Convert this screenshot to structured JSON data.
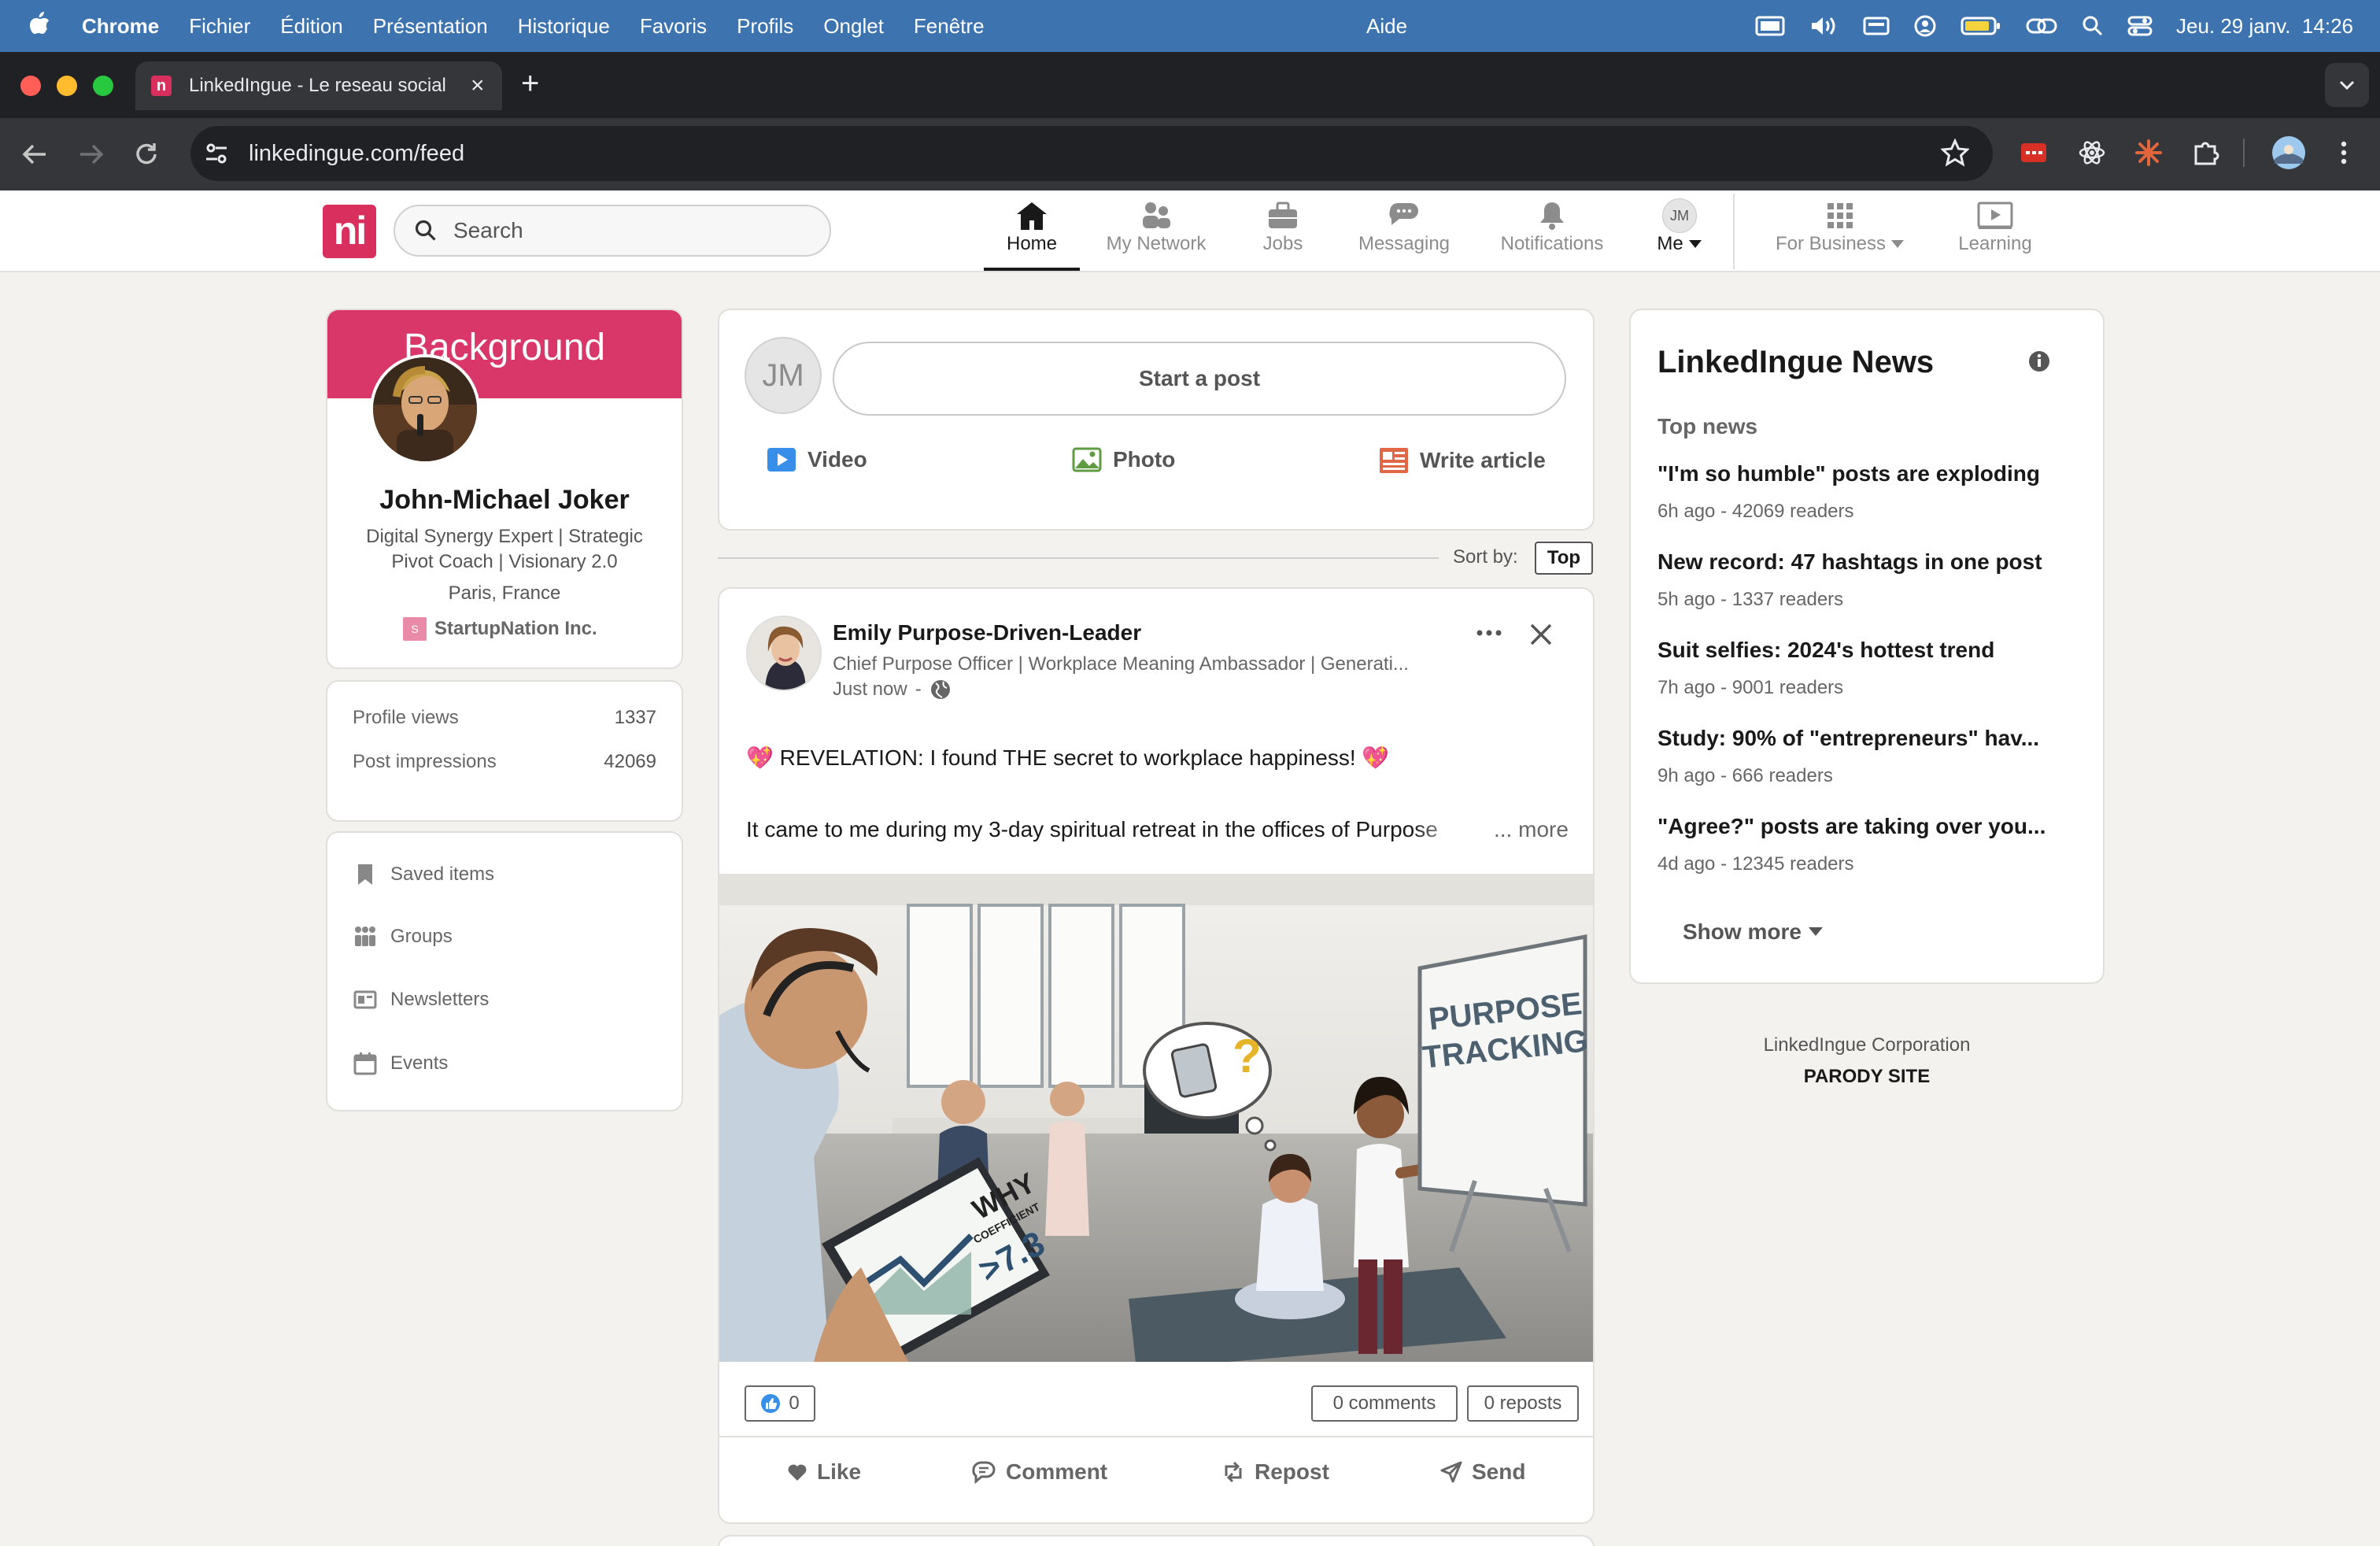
{
  "menubar": {
    "app": "Chrome",
    "items": [
      "Fichier",
      "Édition",
      "Présentation",
      "Historique",
      "Favoris",
      "Profils",
      "Onglet",
      "Fenêtre"
    ],
    "help": "Aide",
    "clock": "Jeu. 29 janv.  14:26"
  },
  "browser": {
    "tab_title": "LinkedIngue - Le reseau social",
    "url": "linkedingue.com/feed"
  },
  "site": {
    "logo": "ni",
    "search_placeholder": "Search",
    "nav": {
      "home": "Home",
      "network": "My Network",
      "jobs": "Jobs",
      "messaging": "Messaging",
      "notifications": "Notifications",
      "me_avatar": "JM",
      "me": "Me",
      "business": "For Business",
      "learning": "Learning"
    }
  },
  "profile": {
    "banner": "Background",
    "name": "John-Michael Joker",
    "headline": "Digital Synergy Expert | Strategic Pivot Coach | Visionary 2.0",
    "location": "Paris, France",
    "company_badge": "S",
    "company": "StartupNation Inc.",
    "stats": [
      {
        "label": "Profile views",
        "value": "1337"
      },
      {
        "label": "Post impressions",
        "value": "42069"
      }
    ],
    "menu": [
      "Saved items",
      "Groups",
      "Newsletters",
      "Events"
    ]
  },
  "composer": {
    "avatar": "JM",
    "start": "Start a post",
    "video": "Video",
    "photo": "Photo",
    "article": "Write article"
  },
  "feed": {
    "sort_label": "Sort by:",
    "sort_value": "Top"
  },
  "post": {
    "author": "Emily Purpose-Driven-Leader",
    "subtitle": "Chief Purpose Officer | Workplace Meaning Ambassador | Generati...",
    "time": "Just now",
    "dash": "-",
    "text1": "💖 REVELATION: I found THE secret to workplace happiness! 💖",
    "text2": "It came to me during my 3-day spiritual retreat in the offices of Purpose",
    "more": "... more",
    "image": {
      "board_line1": "PURPOSE",
      "board_line2": "TRACKING",
      "tablet_big": "WHY",
      "tablet_small": "COEFFICIENT",
      "tablet_value": ">7.3"
    },
    "reactions": "0",
    "comments": "0 comments",
    "reposts": "0 reposts",
    "actions": {
      "like": "Like",
      "comment": "Comment",
      "repost": "Repost",
      "send": "Send"
    }
  },
  "news": {
    "title": "LinkedIngue News",
    "section": "Top news",
    "items": [
      {
        "title": "\"I'm so humble\" posts are exploding",
        "meta": "6h ago - 42069 readers"
      },
      {
        "title": "New record: 47 hashtags in one post",
        "meta": "5h ago - 1337 readers"
      },
      {
        "title": "Suit selfies: 2024's hottest trend",
        "meta": "7h ago - 9001 readers"
      },
      {
        "title": "Study: 90% of \"entrepreneurs\" hav...",
        "meta": "9h ago - 666 readers"
      },
      {
        "title": "\"Agree?\" posts are taking over you...",
        "meta": "4d ago - 12345 readers"
      }
    ],
    "show_more": "Show more"
  },
  "footer": {
    "corp": "LinkedIngue Corporation",
    "parody": "PARODY SITE"
  },
  "colors": {
    "brand": "#d92f5e",
    "menubar": "#3d74b0",
    "page_bg": "#f4f2ee"
  }
}
